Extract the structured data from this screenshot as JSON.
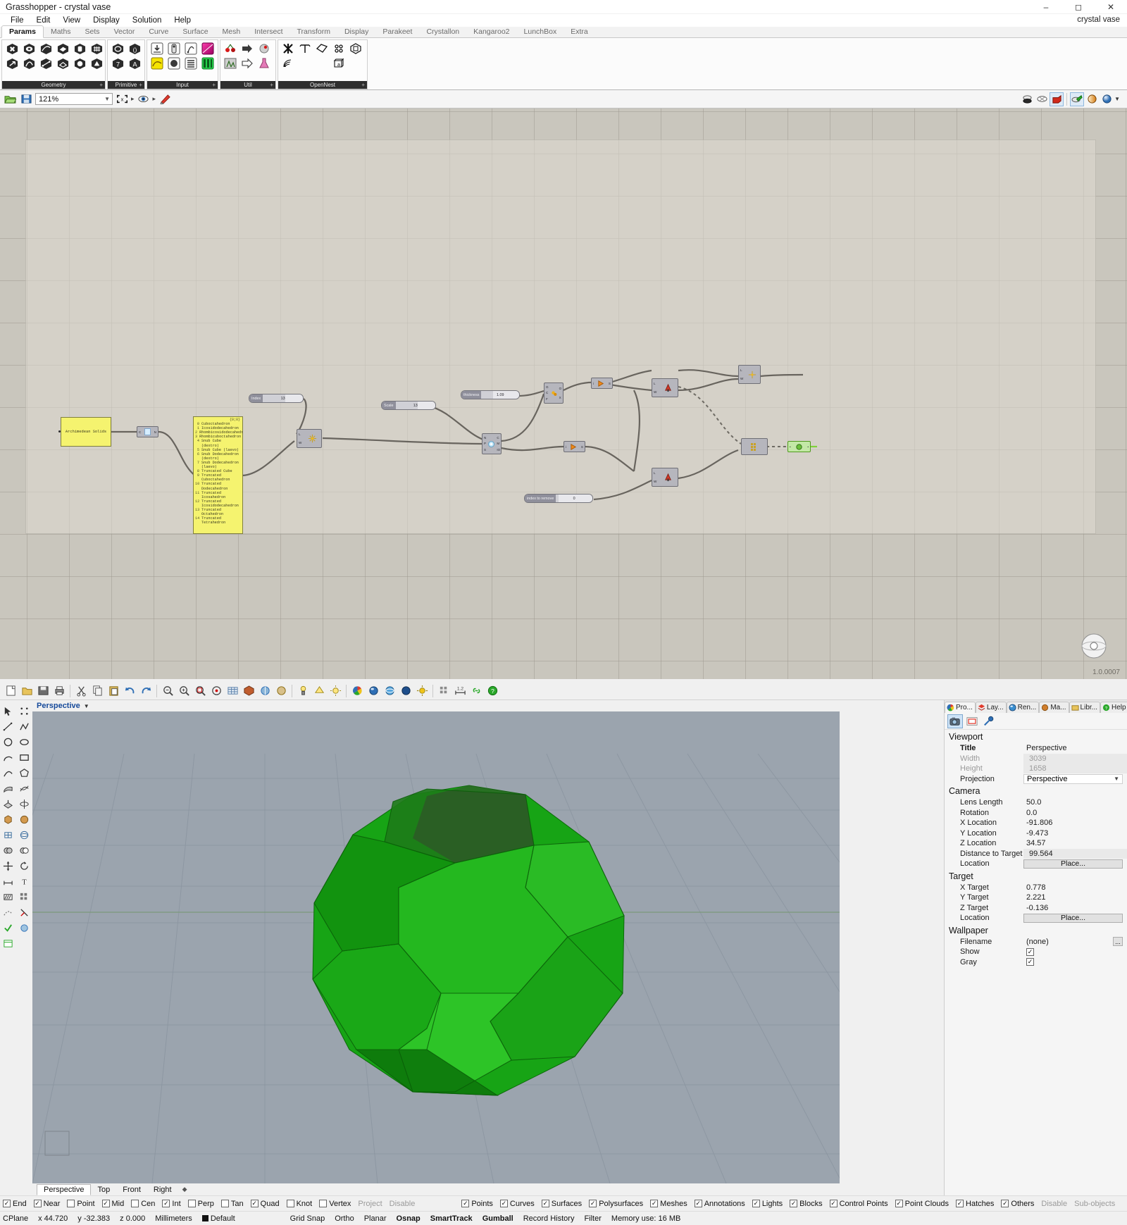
{
  "grasshopper": {
    "title": "Grasshopper - crystal vase",
    "document_name": "crystal vase",
    "version": "1.0.0007",
    "window_buttons": [
      "minimize",
      "maximize",
      "close"
    ],
    "menu": [
      "File",
      "Edit",
      "View",
      "Display",
      "Solution",
      "Help"
    ],
    "ribbon_tabs": [
      "Params",
      "Maths",
      "Sets",
      "Vector",
      "Curve",
      "Surface",
      "Mesh",
      "Intersect",
      "Transform",
      "Display",
      "Parakeet",
      "Crystallon",
      "Kangaroo2",
      "LunchBox",
      "Extra"
    ],
    "active_ribbon_tab": "Params",
    "ribbon_groups": [
      {
        "label": "Geometry",
        "icons": [
          "box-param-icon",
          "brep-param-icon",
          "curve-param-icon",
          "surface-param-icon",
          "mesh-param-icon",
          "geometry-param-icon",
          "vector-param-icon",
          "circle-param-icon",
          "line-param-icon",
          "plane-param-icon",
          "field-param-icon",
          "transform-param-icon"
        ]
      },
      {
        "label": "Primitive",
        "icons": [
          "boolean-param-icon",
          "complex-param-icon",
          "number-param-icon",
          "text-param-icon"
        ]
      },
      {
        "label": "Input",
        "icons": [
          "file-reader-icon",
          "button-icon",
          "gradient-control-icon",
          "colour-swatch-icon",
          "graph-mapper-icon",
          "knob-icon",
          "value-list-icon",
          "image-sampler-icon"
        ]
      },
      {
        "label": "Util",
        "icons": [
          "cherry-picker-icon",
          "data-output-icon",
          "jitter-icon",
          "data-tree-icon",
          "relay-icon",
          "flask-icon"
        ]
      },
      {
        "label": "OpenNest",
        "icons": [
          "opennest-pack-icon",
          "opennest-tee-icon",
          "opennest-tag-icon",
          "opennest-dots-icon",
          "opennest-frame-icon",
          "opennest-wifi-icon",
          "opennest-box-icon"
        ]
      }
    ],
    "canvas_toolbar": {
      "zoom_value": "121%",
      "icons": [
        "open-file-icon",
        "save-file-icon",
        "selection-icon",
        "preview-eye-icon",
        "sketch-icon"
      ],
      "right_icons": [
        "preview-shaded-icon",
        "preview-wireframe-icon",
        "preview-off-icon",
        "document-preview-icon",
        "preview-mesh-icon",
        "preview-settings-icon",
        "preview-colour-icon"
      ]
    },
    "nodes": {
      "archimedean_label": "Archimedean Solids",
      "conduit_label_left": "C",
      "conduit_label_right": "N",
      "panel_header": "{0;0}",
      "panel_items": [
        {
          "index": "0",
          "text": "Cuboctahedron"
        },
        {
          "index": "1",
          "text": "Icosidodecahedron"
        },
        {
          "index": "2",
          "text": "Rhombicosidodecahedron"
        },
        {
          "index": "3",
          "text": "Rhombicuboctahedron"
        },
        {
          "index": "4",
          "text": "Snub Cube (dextro)"
        },
        {
          "index": "5",
          "text": "Snub Cube (laevo)"
        },
        {
          "index": "6",
          "text": "Snub Dodecahedron (dextro)"
        },
        {
          "index": "7",
          "text": "Snub Dodecahedron (laevo)"
        },
        {
          "index": "8",
          "text": "Truncated Cube"
        },
        {
          "index": "9",
          "text": "Truncated Cuboctahedron"
        },
        {
          "index": "10",
          "text": "Truncated Dodecahedron"
        },
        {
          "index": "11",
          "text": "Truncated Icosahedron"
        },
        {
          "index": "12",
          "text": "Truncated Icosidodecahedron"
        },
        {
          "index": "13",
          "text": "Truncated Octahedron"
        },
        {
          "index": "14",
          "text": "Truncated Tetrahedron"
        }
      ],
      "sliders": [
        {
          "name": "Index",
          "value": "13"
        },
        {
          "name": "Scale",
          "value": "13"
        },
        {
          "name": "thickness",
          "value": "1.09"
        },
        {
          "name": "index to remove",
          "value": "0"
        }
      ],
      "components": [
        {
          "id": "list-item",
          "inputs": [
            "L",
            "i"
          ],
          "outputs": [
            "W"
          ]
        },
        {
          "id": "mesh-comp",
          "inputs": [
            "N",
            "P",
            "S"
          ],
          "outputs": [
            "C",
            "M",
            "IO"
          ]
        },
        {
          "id": "geom-comp",
          "inputs": [
            "G",
            "C",
            "F"
          ],
          "outputs": [
            "O",
            "X"
          ]
        },
        {
          "id": "split-comp",
          "inputs": [
            "i"
          ],
          "outputs": [
            "S"
          ]
        },
        {
          "id": "loft-comp",
          "inputs": [
            "L"
          ],
          "outputs": [
            "W"
          ]
        },
        {
          "id": "brep-comp",
          "inputs": [
            "L"
          ],
          "outputs": [
            "W"
          ]
        },
        {
          "id": "series-comp",
          "inputs": [
            "L"
          ],
          "outputs": [
            "W"
          ]
        },
        {
          "id": "grid-comp",
          "inputs": [],
          "outputs": []
        },
        {
          "id": "preview-comp",
          "inputs": [],
          "outputs": []
        }
      ]
    }
  },
  "rhino": {
    "toolbar_icons": [
      "new-icon",
      "open-icon",
      "save-icon",
      "print-icon",
      "cut-icon",
      "copy-icon",
      "paste-icon",
      "undo-icon",
      "redo-icon",
      "zoom-window-icon",
      "zoom-extents-icon",
      "zoom-selected-icon",
      "zoom-target-icon",
      "grid-icon",
      "shade-icon",
      "render-icon",
      "render-preview-icon",
      "spotlight-icon",
      "directional-light-icon",
      "point-light-icon",
      "colour-wheel-icon",
      "material-icon",
      "environment-icon",
      "sphere-icon",
      "sun-icon",
      "settings-icon",
      "measure-icon",
      "link-icon",
      "help-icon"
    ],
    "viewport": {
      "title": "Perspective",
      "bottom_tabs": [
        "Perspective",
        "Top",
        "Front",
        "Right"
      ],
      "active_bottom_tab": "Perspective",
      "geometry_colour": "#1aa318"
    },
    "properties": {
      "tabs": [
        {
          "label": "Pro...",
          "icon": "properties-icon"
        },
        {
          "label": "Lay...",
          "icon": "layers-icon"
        },
        {
          "label": "Ren...",
          "icon": "render-icon"
        },
        {
          "label": "Ma...",
          "icon": "materials-icon"
        },
        {
          "label": "Libr...",
          "icon": "libraries-icon"
        },
        {
          "label": "Help",
          "icon": "help-icon"
        }
      ],
      "active_tab": "Pro...",
      "icon_buttons": [
        "camera-icon",
        "viewport-icon",
        "display-icon"
      ],
      "sections": [
        {
          "title": "Viewport",
          "rows": [
            {
              "key": "Title",
              "value": "Perspective",
              "type": "text",
              "key_style": "bold"
            },
            {
              "key": "Width",
              "value": "3039",
              "type": "readonly"
            },
            {
              "key": "Height",
              "value": "1658",
              "type": "readonly"
            },
            {
              "key": "Projection",
              "value": "Perspective",
              "type": "select"
            }
          ]
        },
        {
          "title": "Camera",
          "rows": [
            {
              "key": "Lens Length",
              "value": "50.0",
              "type": "text"
            },
            {
              "key": "Rotation",
              "value": "0.0",
              "type": "text"
            },
            {
              "key": "X Location",
              "value": "-91.806",
              "type": "text"
            },
            {
              "key": "Y Location",
              "value": "-9.473",
              "type": "text"
            },
            {
              "key": "Z Location",
              "value": "34.57",
              "type": "text"
            },
            {
              "key": "Distance to Target",
              "value": "99.564",
              "type": "shaded"
            },
            {
              "key": "Location",
              "value": "Place...",
              "type": "button"
            }
          ]
        },
        {
          "title": "Target",
          "rows": [
            {
              "key": "X Target",
              "value": "0.778",
              "type": "text"
            },
            {
              "key": "Y Target",
              "value": "2.221",
              "type": "text"
            },
            {
              "key": "Z Target",
              "value": "-0.136",
              "type": "text"
            },
            {
              "key": "Location",
              "value": "Place...",
              "type": "button"
            }
          ]
        },
        {
          "title": "Wallpaper",
          "rows": [
            {
              "key": "Filename",
              "value": "(none)",
              "type": "file"
            },
            {
              "key": "Show",
              "value": "checked",
              "type": "checkbox"
            },
            {
              "key": "Gray",
              "value": "checked",
              "type": "checkbox"
            }
          ]
        }
      ]
    },
    "osnap_bar": [
      {
        "label": "End",
        "checked": true
      },
      {
        "label": "Near",
        "checked": true
      },
      {
        "label": "Point",
        "checked": false
      },
      {
        "label": "Mid",
        "checked": true
      },
      {
        "label": "Cen",
        "checked": false
      },
      {
        "label": "Int",
        "checked": true
      },
      {
        "label": "Perp",
        "checked": false
      },
      {
        "label": "Tan",
        "checked": false
      },
      {
        "label": "Quad",
        "checked": true
      },
      {
        "label": "Knot",
        "checked": false
      },
      {
        "label": "Vertex",
        "checked": false
      },
      {
        "label": "Project",
        "checked": null
      },
      {
        "label": "Disable",
        "checked": null
      }
    ],
    "filter_bar": [
      {
        "label": "Points",
        "checked": true
      },
      {
        "label": "Curves",
        "checked": true
      },
      {
        "label": "Surfaces",
        "checked": true
      },
      {
        "label": "Polysurfaces",
        "checked": true
      },
      {
        "label": "Meshes",
        "checked": true
      },
      {
        "label": "Annotations",
        "checked": true
      },
      {
        "label": "Lights",
        "checked": true
      },
      {
        "label": "Blocks",
        "checked": true
      },
      {
        "label": "Control Points",
        "checked": true
      },
      {
        "label": "Point Clouds",
        "checked": true
      },
      {
        "label": "Hatches",
        "checked": true
      },
      {
        "label": "Others",
        "checked": true
      },
      {
        "label": "Disable",
        "checked": null
      },
      {
        "label": "Sub-objects",
        "checked": null
      }
    ],
    "statusbar": {
      "cplane": "CPlane",
      "x": "x 44.720",
      "y": "y -32.383",
      "z": "z 0.000",
      "units": "Millimeters",
      "layer": "Default",
      "toggles": [
        "Grid Snap",
        "Ortho",
        "Planar",
        "Osnap",
        "SmartTrack",
        "Gumball",
        "Record History",
        "Filter"
      ],
      "bold_toggles": [
        "Osnap",
        "SmartTrack",
        "Gumball"
      ],
      "memory": "Memory use: 16 MB"
    }
  }
}
